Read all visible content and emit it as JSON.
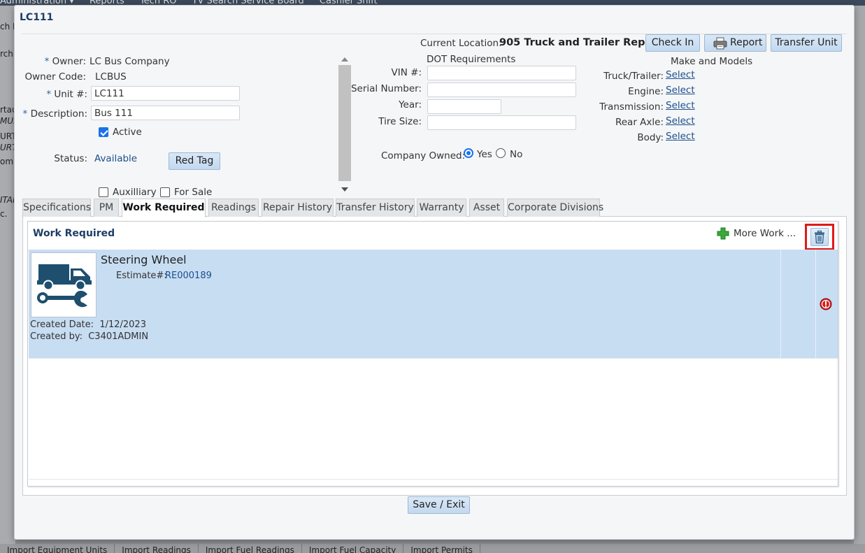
{
  "background": {
    "menu": [
      "Administration ▾",
      "Reports",
      "Tech RO",
      "TV Search Service Board",
      "Cashier Shift"
    ],
    "left_fragments": [
      "ch F",
      "rch",
      "rtau",
      "MUR",
      "URT",
      "URT",
      "omp",
      "ITAI",
      "c."
    ],
    "bottom_tabs": [
      "Import Equipment Units",
      "Import Readings",
      "Import Fuel Readings",
      "Import Fuel Capacity",
      "Import Permits"
    ]
  },
  "dialog": {
    "title": "LC111",
    "current_location_label": "Current Location:",
    "current_location_value": "905 Truck and Trailer Repair",
    "buttons": {
      "check_in": "Check In",
      "report": "Report",
      "transfer_unit": "Transfer Unit",
      "save_exit": "Save / Exit",
      "red_tag": "Red Tag"
    },
    "owner": {
      "label": "Owner:",
      "value": "LC Bus Company"
    },
    "owner_code": {
      "label": "Owner Code:",
      "value": "LCBUS"
    },
    "unit_no": {
      "label": "Unit #:",
      "value": "LC111"
    },
    "description": {
      "label": "Description:",
      "value": "Bus 111"
    },
    "active": {
      "label": "Active",
      "checked": true
    },
    "status": {
      "label": "Status:",
      "value": "Available"
    },
    "auxiliary": {
      "label": "Auxilliary",
      "checked": false
    },
    "for_sale": {
      "label": "For Sale",
      "checked": false
    },
    "required_marker": "*",
    "dot": {
      "title": "DOT Requirements",
      "vin_label": "VIN #:",
      "vin_value": "",
      "serial_label": "Serial Number:",
      "serial_value": "",
      "year_label": "Year:",
      "year_value": "",
      "tire_label": "Tire Size:",
      "tire_value": "",
      "company_owned_label": "Company Owned:",
      "yes_label": "Yes",
      "no_label": "No",
      "company_owned": "Yes"
    },
    "make_models": {
      "title": "Make and Models",
      "items": [
        {
          "label": "Truck/Trailer:",
          "link": "Select"
        },
        {
          "label": "Engine:",
          "link": "Select"
        },
        {
          "label": "Transmission:",
          "link": "Select"
        },
        {
          "label": "Rear Axle:",
          "link": "Select"
        },
        {
          "label": "Body:",
          "link": "Select"
        }
      ]
    },
    "tabs": [
      "Specifications",
      "PM",
      "Work Required",
      "Readings",
      "Repair History",
      "Transfer History",
      "Warranty",
      "Asset",
      "Corporate Divisions"
    ],
    "active_tab": "Work Required",
    "work_required": {
      "title": "Work Required",
      "more_work": "More Work ...",
      "item": {
        "title": "Steering Wheel",
        "estimate_label": "Estimate#:",
        "estimate_value": "RE000189",
        "created_date_label": "Created Date:",
        "created_date_value": "1/12/2023",
        "created_by_label": "Created by:",
        "created_by_value": "C3401ADMIN"
      }
    }
  },
  "icons": [
    "printer-icon",
    "plus-icon",
    "trash-icon",
    "alert-icon",
    "truck-wrench-icon"
  ],
  "colors": {
    "accent": "#1a73e8",
    "title": "#1f3e66",
    "link": "#1c4f8d",
    "row_highlight": "#c7ddf2",
    "annotation": "#e01919"
  }
}
